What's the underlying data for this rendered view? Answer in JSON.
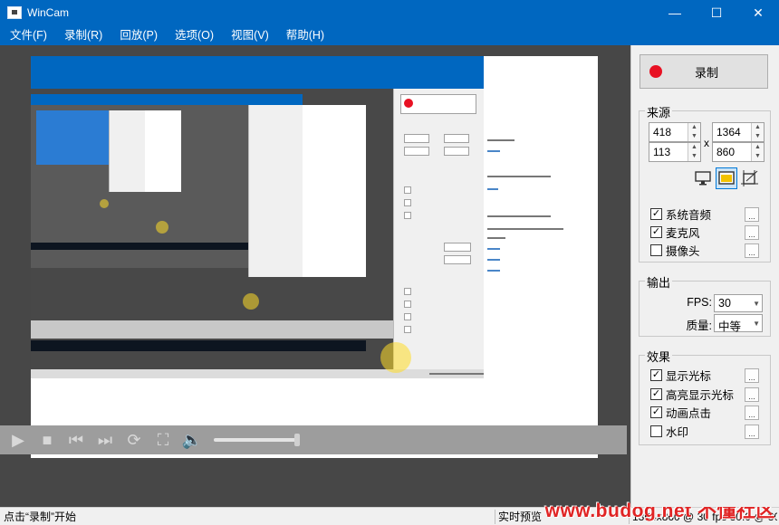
{
  "app": {
    "title": "WinCam"
  },
  "window_controls": {
    "minimize": "—",
    "maximize": "☐",
    "close": "✕"
  },
  "menu": [
    "文件(F)",
    "录制(R)",
    "回放(P)",
    "选项(O)",
    "视图(V)",
    "帮助(H)"
  ],
  "record_button": {
    "label": "录制",
    "icon": "record-dot-icon",
    "color": "#e81123"
  },
  "source": {
    "title": "来源",
    "x": "418",
    "y": "113",
    "width": "1364",
    "height": "860",
    "separator": "x",
    "modes": [
      "fullscreen-icon",
      "window-icon",
      "region-icon"
    ],
    "active_mode": 1,
    "options": [
      {
        "label": "系统音频",
        "checked": true,
        "option_label": "..."
      },
      {
        "label": "麦克风",
        "checked": true,
        "option_label": "..."
      },
      {
        "label": "摄像头",
        "checked": false,
        "option_label": "..."
      }
    ]
  },
  "output": {
    "title": "输出",
    "fps_label": "FPS:",
    "fps_value": "30",
    "quality_label": "质量:",
    "quality_value": "中等"
  },
  "effects": {
    "title": "效果",
    "options": [
      {
        "label": "显示光标",
        "checked": true,
        "option_label": "..."
      },
      {
        "label": "高亮显示光标",
        "checked": true,
        "option_label": "..."
      },
      {
        "label": "动画点击",
        "checked": true,
        "option_label": "..."
      },
      {
        "label": "水印",
        "checked": false,
        "option_label": "..."
      }
    ]
  },
  "playback": {
    "progress": 0.92
  },
  "status": {
    "left": "点击“录制”开始",
    "middle": "实时预览",
    "right": "1364x860 @ 30 fps 30.0 @ 30"
  },
  "watermark": "www.budog.net 不懂社区",
  "colors": {
    "accent": "#0067c0",
    "record": "#e81123",
    "capture_bg": "#474747",
    "highlight": "#ffdc28"
  }
}
